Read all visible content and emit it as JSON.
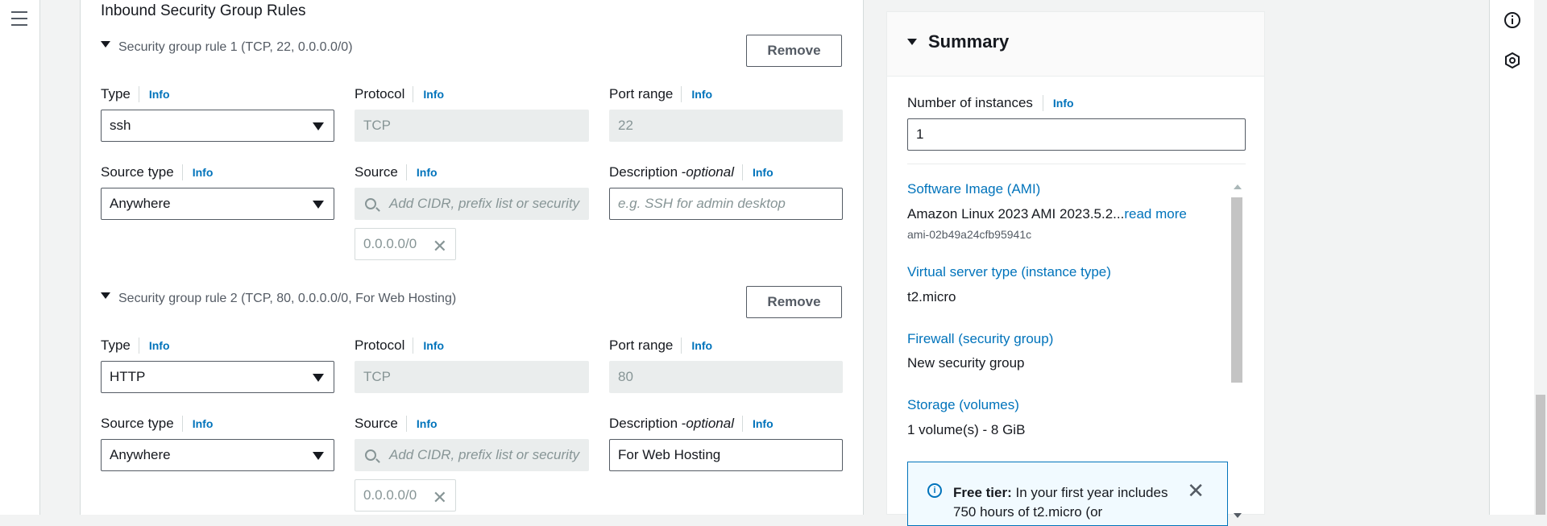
{
  "section_title": "Inbound Security Group Rules",
  "rules": [
    {
      "header": "Security group rule 1 (TCP, 22, 0.0.0.0/0)",
      "remove_label": "Remove",
      "type_label": "Type",
      "type_value": "ssh",
      "protocol_label": "Protocol",
      "protocol_value": "TCP",
      "port_label": "Port range",
      "port_value": "22",
      "source_type_label": "Source type",
      "source_type_value": "Anywhere",
      "source_label": "Source",
      "source_placeholder": "Add CIDR, prefix list or security",
      "source_token": "0.0.0.0/0",
      "desc_label": "Description - ",
      "desc_label_optional": "optional",
      "desc_value": "",
      "desc_placeholder": "e.g. SSH for admin desktop"
    },
    {
      "header": "Security group rule 2 (TCP, 80, 0.0.0.0/0, For Web Hosting)",
      "remove_label": "Remove",
      "type_label": "Type",
      "type_value": "HTTP",
      "protocol_label": "Protocol",
      "protocol_value": "TCP",
      "port_label": "Port range",
      "port_value": "80",
      "source_type_label": "Source type",
      "source_type_value": "Anywhere",
      "source_label": "Source",
      "source_placeholder": "Add CIDR, prefix list or security",
      "source_token": "0.0.0.0/0",
      "desc_label": "Description - ",
      "desc_label_optional": "optional",
      "desc_value": "For Web Hosting",
      "desc_placeholder": ""
    }
  ],
  "info_label": "Info",
  "summary": {
    "title": "Summary",
    "instances_label": "Number of instances",
    "instances_value": "1",
    "ami_label": "Software Image (AMI)",
    "ami_value": "Amazon Linux 2023 AMI 2023.5.2...",
    "ami_readmore": "read more",
    "ami_id": "ami-02b49a24cfb95941c",
    "instance_type_label": "Virtual server type (instance type)",
    "instance_type_value": "t2.micro",
    "firewall_label": "Firewall (security group)",
    "firewall_value": "New security group",
    "storage_label": "Storage (volumes)",
    "storage_value": "1 volume(s) - 8 GiB",
    "free_tier_bold": "Free tier:",
    "free_tier_text": " In your first year includes 750 hours of t2.micro (or"
  },
  "colors": {
    "link": "#0073bb",
    "border": "#545b64",
    "disabled_bg": "#eaeded"
  }
}
